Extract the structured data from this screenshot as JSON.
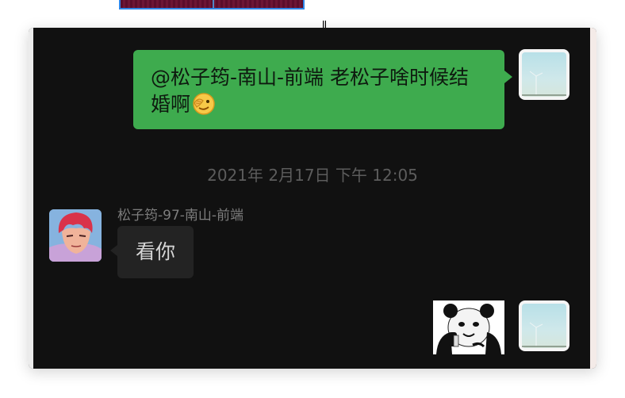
{
  "chat": {
    "outgoing_message": "@松子筠-南山-前端 老松子啥时候结婚啊",
    "timestamp": "2021年 2月17日 下午 12:05",
    "sender_name": "松子筠-97-南山-前端",
    "incoming_message": "看你"
  },
  "icons": {
    "crosshair": "crosshair-cursor-icon",
    "emoji": "eye-patch-emoji-icon",
    "sticker": "panda-meme-sticker-icon"
  },
  "colors": {
    "chat_background": "#111111",
    "outgoing_bubble": "#3eab4e",
    "incoming_bubble": "#232323",
    "selection_border": "#2f86e8"
  }
}
